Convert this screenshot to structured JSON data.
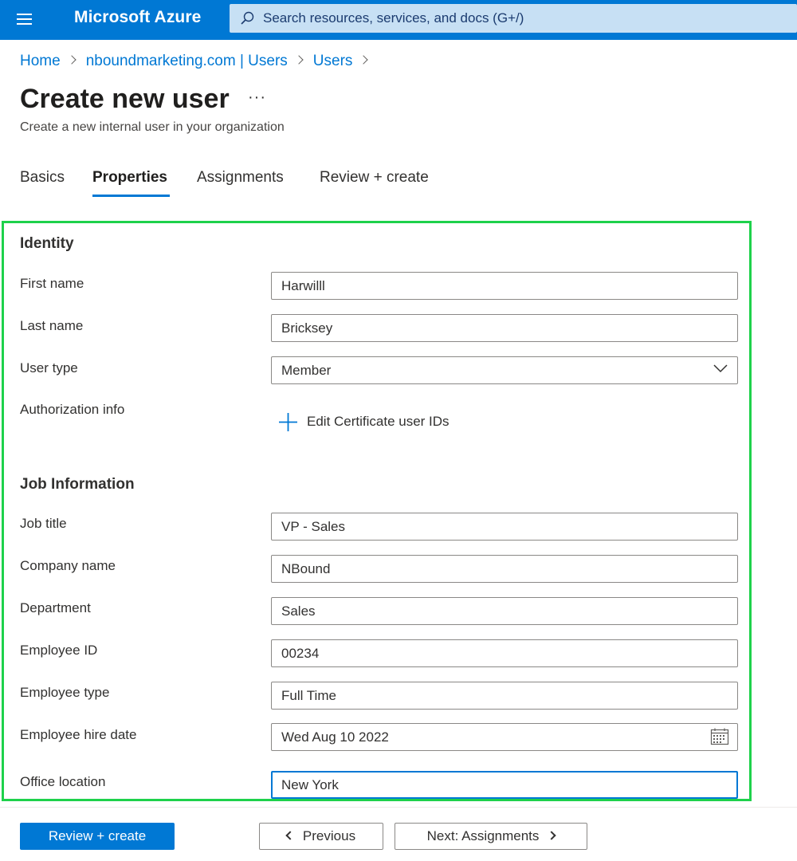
{
  "topbar": {
    "brand": "Microsoft Azure",
    "search_placeholder": "Search resources, services, and docs (G+/)"
  },
  "breadcrumb": [
    "Home",
    "nboundmarketing.com | Users",
    "Users"
  ],
  "header": {
    "title": "Create new user",
    "more": "···",
    "subtitle": "Create a new internal user in your organization"
  },
  "tabs": [
    {
      "label": "Basics",
      "active": false
    },
    {
      "label": "Properties",
      "active": true
    },
    {
      "label": "Assignments",
      "active": false
    },
    {
      "label": "Review + create",
      "active": false
    }
  ],
  "identity": {
    "heading": "Identity",
    "first_name_label": "First name",
    "first_name_value": "Harwilll",
    "last_name_label": "Last name",
    "last_name_value": "Bricksey",
    "user_type_label": "User type",
    "user_type_value": "Member",
    "authorization_label": "Authorization info",
    "edit_cert_label": "Edit Certificate user IDs"
  },
  "job": {
    "heading": "Job Information",
    "job_title_label": "Job title",
    "job_title_value": "VP - Sales",
    "company_label": "Company name",
    "company_value": "NBound",
    "department_label": "Department",
    "department_value": "Sales",
    "employee_id_label": "Employee ID",
    "employee_id_value": "00234",
    "employee_type_label": "Employee type",
    "employee_type_value": "Full Time",
    "hire_date_label": "Employee hire date",
    "hire_date_value": "Wed Aug 10 2022",
    "office_label": "Office location",
    "office_value": "New York"
  },
  "footer": {
    "review_create": "Review + create",
    "previous": "Previous",
    "next": "Next: Assignments"
  },
  "colors": {
    "accent": "#0078d4",
    "highlight_frame": "#1ed14b"
  }
}
